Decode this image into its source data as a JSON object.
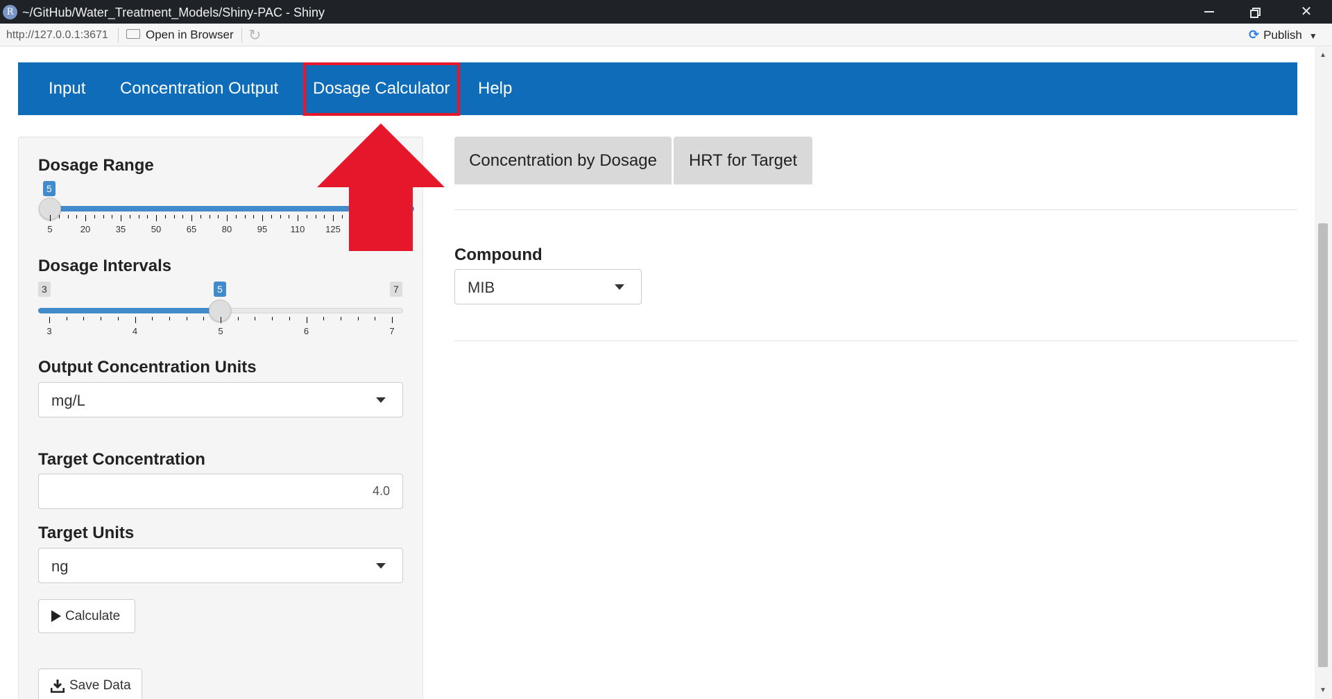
{
  "window": {
    "app_icon": "R",
    "title": "~/GitHub/Water_Treatment_Models/Shiny-PAC - Shiny",
    "controls": [
      "minimize-icon",
      "restore-icon",
      "close-icon"
    ]
  },
  "toolbar": {
    "url": "http://127.0.0.1:3671",
    "open_in_browser": "Open in Browser",
    "publish": "Publish"
  },
  "navbar": {
    "items": [
      "Input",
      "Concentration Output",
      "Dosage Calculator",
      "Help"
    ],
    "active": "Dosage Calculator",
    "highlight_color": "#e6172a",
    "background_color": "#0f6cb8"
  },
  "sidebar": {
    "dosage_range": {
      "label": "Dosage Range",
      "value": "5",
      "ticks": [
        "5",
        "20",
        "35",
        "50",
        "65",
        "80",
        "95",
        "110",
        "125"
      ]
    },
    "dosage_intervals": {
      "label": "Dosage Intervals",
      "min": "3",
      "max": "7",
      "value": "5",
      "ticks": [
        "3",
        "4",
        "5",
        "6",
        "7"
      ]
    },
    "output_units": {
      "label": "Output Concentration Units",
      "value": "mg/L"
    },
    "target_concentration": {
      "label": "Target Concentration",
      "value": "4.0"
    },
    "target_units": {
      "label": "Target Units",
      "value": "ng"
    },
    "calculate_button": "Calculate",
    "save_button": "Save Data"
  },
  "main": {
    "tabs": [
      "Concentration by Dosage",
      "HRT for Target"
    ],
    "compound": {
      "label": "Compound",
      "value": "MIB"
    }
  },
  "annotation": {
    "arrow_color": "#e6172a"
  }
}
